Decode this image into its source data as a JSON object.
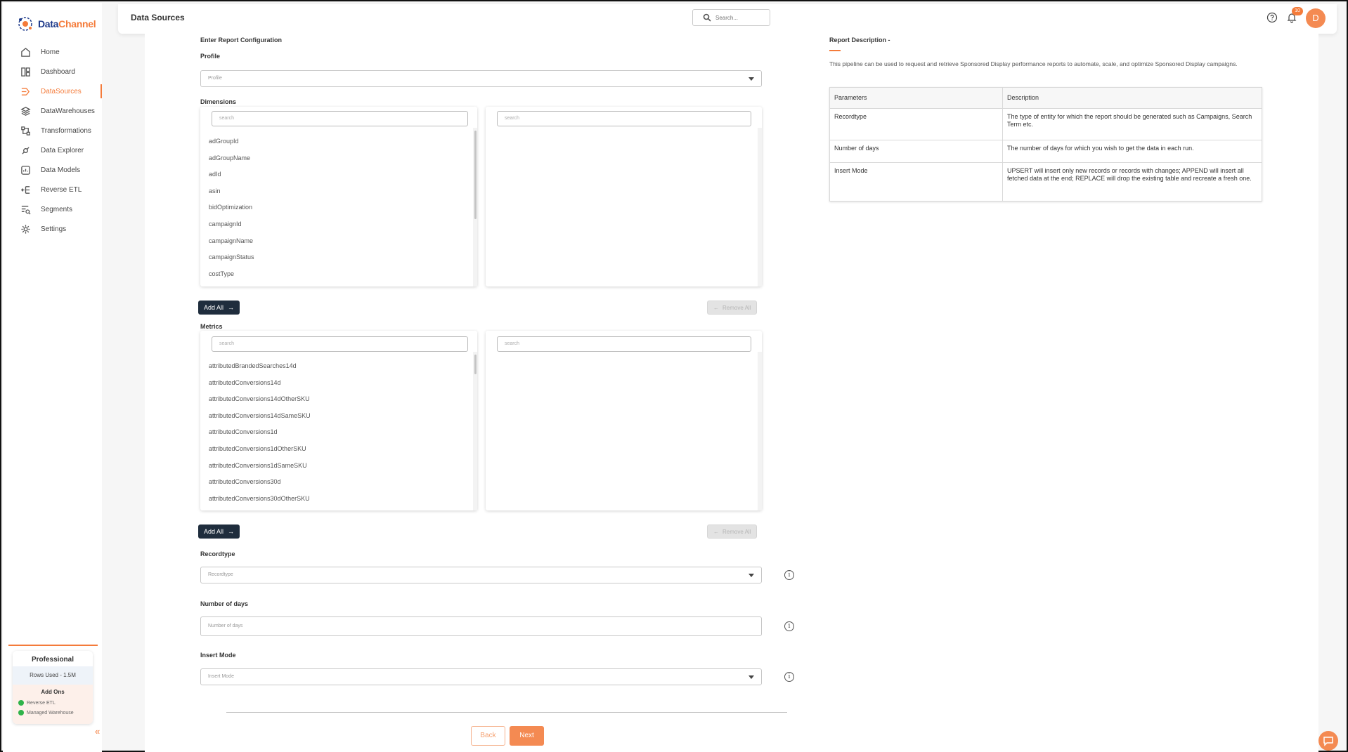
{
  "app": {
    "logo_text_dark": "Data",
    "logo_text_accent": "Channel",
    "page_title": "Data Sources"
  },
  "header": {
    "search_placeholder": "Search...",
    "notification_count": "10",
    "avatar_initial": "D"
  },
  "sidebar": {
    "items": [
      {
        "label": "Home",
        "icon": "home-icon"
      },
      {
        "label": "Dashboard",
        "icon": "dashboard-icon"
      },
      {
        "label": "DataSources",
        "icon": "datasources-icon",
        "active": true
      },
      {
        "label": "DataWarehouses",
        "icon": "layers-icon"
      },
      {
        "label": "Transformations",
        "icon": "transform-icon"
      },
      {
        "label": "Data Explorer",
        "icon": "explorer-icon"
      },
      {
        "label": "Data Models",
        "icon": "models-icon"
      },
      {
        "label": "Reverse ETL",
        "icon": "reverse-etl-icon"
      },
      {
        "label": "Segments",
        "icon": "segments-icon"
      },
      {
        "label": "Settings",
        "icon": "gear-icon"
      }
    ],
    "plan": {
      "title": "Professional",
      "rows_used": "Rows Used - 1.5M",
      "addons_title": "Add Ons",
      "addons": [
        "Reverse ETL",
        "Managed Warehouse"
      ]
    }
  },
  "form": {
    "section_title": "Enter Report Configuration",
    "profile_label": "Profile",
    "profile_placeholder": "Profile",
    "dimensions_label": "Dimensions",
    "search_placeholder": "search",
    "dimensions": [
      "adGroupId",
      "adGroupName",
      "adId",
      "asin",
      "bidOptimization",
      "campaignId",
      "campaignName",
      "campaignStatus",
      "costType"
    ],
    "metrics_label": "Metrics",
    "metrics": [
      "attributedBrandedSearches14d",
      "attributedConversions14d",
      "attributedConversions14dOtherSKU",
      "attributedConversions14dSameSKU",
      "attributedConversions1d",
      "attributedConversions1dOtherSKU",
      "attributedConversions1dSameSKU",
      "attributedConversions30d",
      "attributedConversions30dOtherSKU"
    ],
    "add_all": "Add All",
    "remove_all": "Remove All",
    "recordtype_label": "Recordtype",
    "recordtype_placeholder": "Recordtype",
    "days_label": "Number of days",
    "days_placeholder": "Number of days",
    "insert_label": "Insert Mode",
    "insert_placeholder": "Insert Mode",
    "back": "Back",
    "next": "Next"
  },
  "description": {
    "title": "Report Description -",
    "text": "This pipeline can be used to request and retrieve Sponsored Display performance reports to automate, scale, and optimize Sponsored Display campaigns.",
    "table_headers": [
      "Parameters",
      "Description"
    ],
    "rows": [
      {
        "param": "Recordtype",
        "desc": "The type of entity for which the report should be generated such as Campaigns, Search Term etc."
      },
      {
        "param": "Number of days",
        "desc": "The number of days for which you wish to get the data in each run."
      },
      {
        "param": "Insert Mode",
        "desc": "UPSERT will insert only new records or records with changes; APPEND will insert all fetched data at the end; REPLACE will drop the existing table and recreate a fresh one."
      }
    ]
  },
  "colors": {
    "accent": "#f47b3a",
    "dark_button": "#1f2d3d"
  }
}
